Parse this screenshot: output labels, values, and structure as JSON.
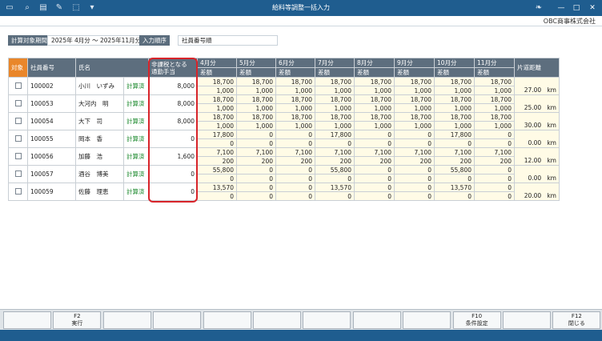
{
  "window": {
    "title": "給料等調整一括入力",
    "min": "—",
    "max": "□",
    "close": "✕"
  },
  "brand": {
    "company": "OBC商事株式会社"
  },
  "conditions": {
    "period_label": "計算対象期間",
    "period_value": "2025年 4月分 〜 2025年11月分",
    "order_label": "入力順序",
    "order_value": "社員番号順"
  },
  "headers": {
    "target": "対象",
    "emp_no": "社員番号",
    "name": "氏名",
    "allowance_1": "非課税となる",
    "allowance_2": "通勤手当",
    "months": [
      "4月分",
      "5月分",
      "6月分",
      "7月分",
      "8月分",
      "9月分",
      "10月分",
      "11月分"
    ],
    "diff": "差額",
    "distance": "片道距離"
  },
  "rows": [
    {
      "no": "100002",
      "name": "小川　いずみ",
      "status": "計算済",
      "allowance": "8,000",
      "top": [
        "18,700",
        "18,700",
        "18,700",
        "18,700",
        "18,700",
        "18,700",
        "18,700",
        "18,700"
      ],
      "bot": [
        "1,000",
        "1,000",
        "1,000",
        "1,000",
        "1,000",
        "1,000",
        "1,000",
        "1,000"
      ],
      "dist": "27.00",
      "unit": "km"
    },
    {
      "no": "100053",
      "name": "大河内　明",
      "status": "計算済",
      "allowance": "8,000",
      "top": [
        "18,700",
        "18,700",
        "18,700",
        "18,700",
        "18,700",
        "18,700",
        "18,700",
        "18,700"
      ],
      "bot": [
        "1,000",
        "1,000",
        "1,000",
        "1,000",
        "1,000",
        "1,000",
        "1,000",
        "1,000"
      ],
      "dist": "25.00",
      "unit": "km"
    },
    {
      "no": "100054",
      "name": "大下　司",
      "status": "計算済",
      "allowance": "8,000",
      "top": [
        "18,700",
        "18,700",
        "18,700",
        "18,700",
        "18,700",
        "18,700",
        "18,700",
        "18,700"
      ],
      "bot": [
        "1,000",
        "1,000",
        "1,000",
        "1,000",
        "1,000",
        "1,000",
        "1,000",
        "1,000"
      ],
      "dist": "30.00",
      "unit": "km"
    },
    {
      "no": "100055",
      "name": "岡本　香",
      "status": "計算済",
      "allowance": "0",
      "top": [
        "17,800",
        "0",
        "0",
        "17,800",
        "0",
        "0",
        "17,800",
        "0"
      ],
      "bot": [
        "0",
        "0",
        "0",
        "0",
        "0",
        "0",
        "0",
        "0"
      ],
      "dist": "0.00",
      "unit": "km"
    },
    {
      "no": "100056",
      "name": "加藤　浩",
      "status": "計算済",
      "allowance": "1,600",
      "top": [
        "7,100",
        "7,100",
        "7,100",
        "7,100",
        "7,100",
        "7,100",
        "7,100",
        "7,100"
      ],
      "bot": [
        "200",
        "200",
        "200",
        "200",
        "200",
        "200",
        "200",
        "200"
      ],
      "dist": "12.00",
      "unit": "km"
    },
    {
      "no": "100057",
      "name": "酒谷　博美",
      "status": "計算済",
      "allowance": "0",
      "top": [
        "55,800",
        "0",
        "0",
        "55,800",
        "0",
        "0",
        "55,800",
        "0"
      ],
      "bot": [
        "0",
        "0",
        "0",
        "0",
        "0",
        "0",
        "0",
        "0"
      ],
      "dist": "0.00",
      "unit": "km"
    },
    {
      "no": "100059",
      "name": "佐藤　理恵",
      "status": "計算済",
      "allowance": "0",
      "top": [
        "13,570",
        "0",
        "0",
        "13,570",
        "0",
        "0",
        "13,570",
        "0"
      ],
      "bot": [
        "0",
        "0",
        "0",
        "0",
        "0",
        "0",
        "0",
        "0"
      ],
      "dist": "20.00",
      "unit": "km"
    }
  ],
  "fkeys": [
    {
      "key": "",
      "label": ""
    },
    {
      "key": "F2",
      "label": "実行"
    },
    {
      "key": "",
      "label": ""
    },
    {
      "key": "",
      "label": ""
    },
    {
      "key": "",
      "label": ""
    },
    {
      "key": "",
      "label": ""
    },
    {
      "key": "",
      "label": ""
    },
    {
      "key": "",
      "label": ""
    },
    {
      "key": "",
      "label": ""
    },
    {
      "key": "F10",
      "label": "条件設定"
    },
    {
      "key": "",
      "label": ""
    },
    {
      "key": "F12",
      "label": "閉じる"
    }
  ],
  "icons": [
    "menu-icon",
    "search-icon",
    "print-icon",
    "tool-icon",
    "export-icon",
    "dropdown-icon"
  ],
  "colors": {
    "titlebar": "#1f5d8f",
    "header": "#5d6e7e",
    "selected_header": "#e9862a",
    "status": "#1c8a2e",
    "highlight": "#d8242a"
  }
}
